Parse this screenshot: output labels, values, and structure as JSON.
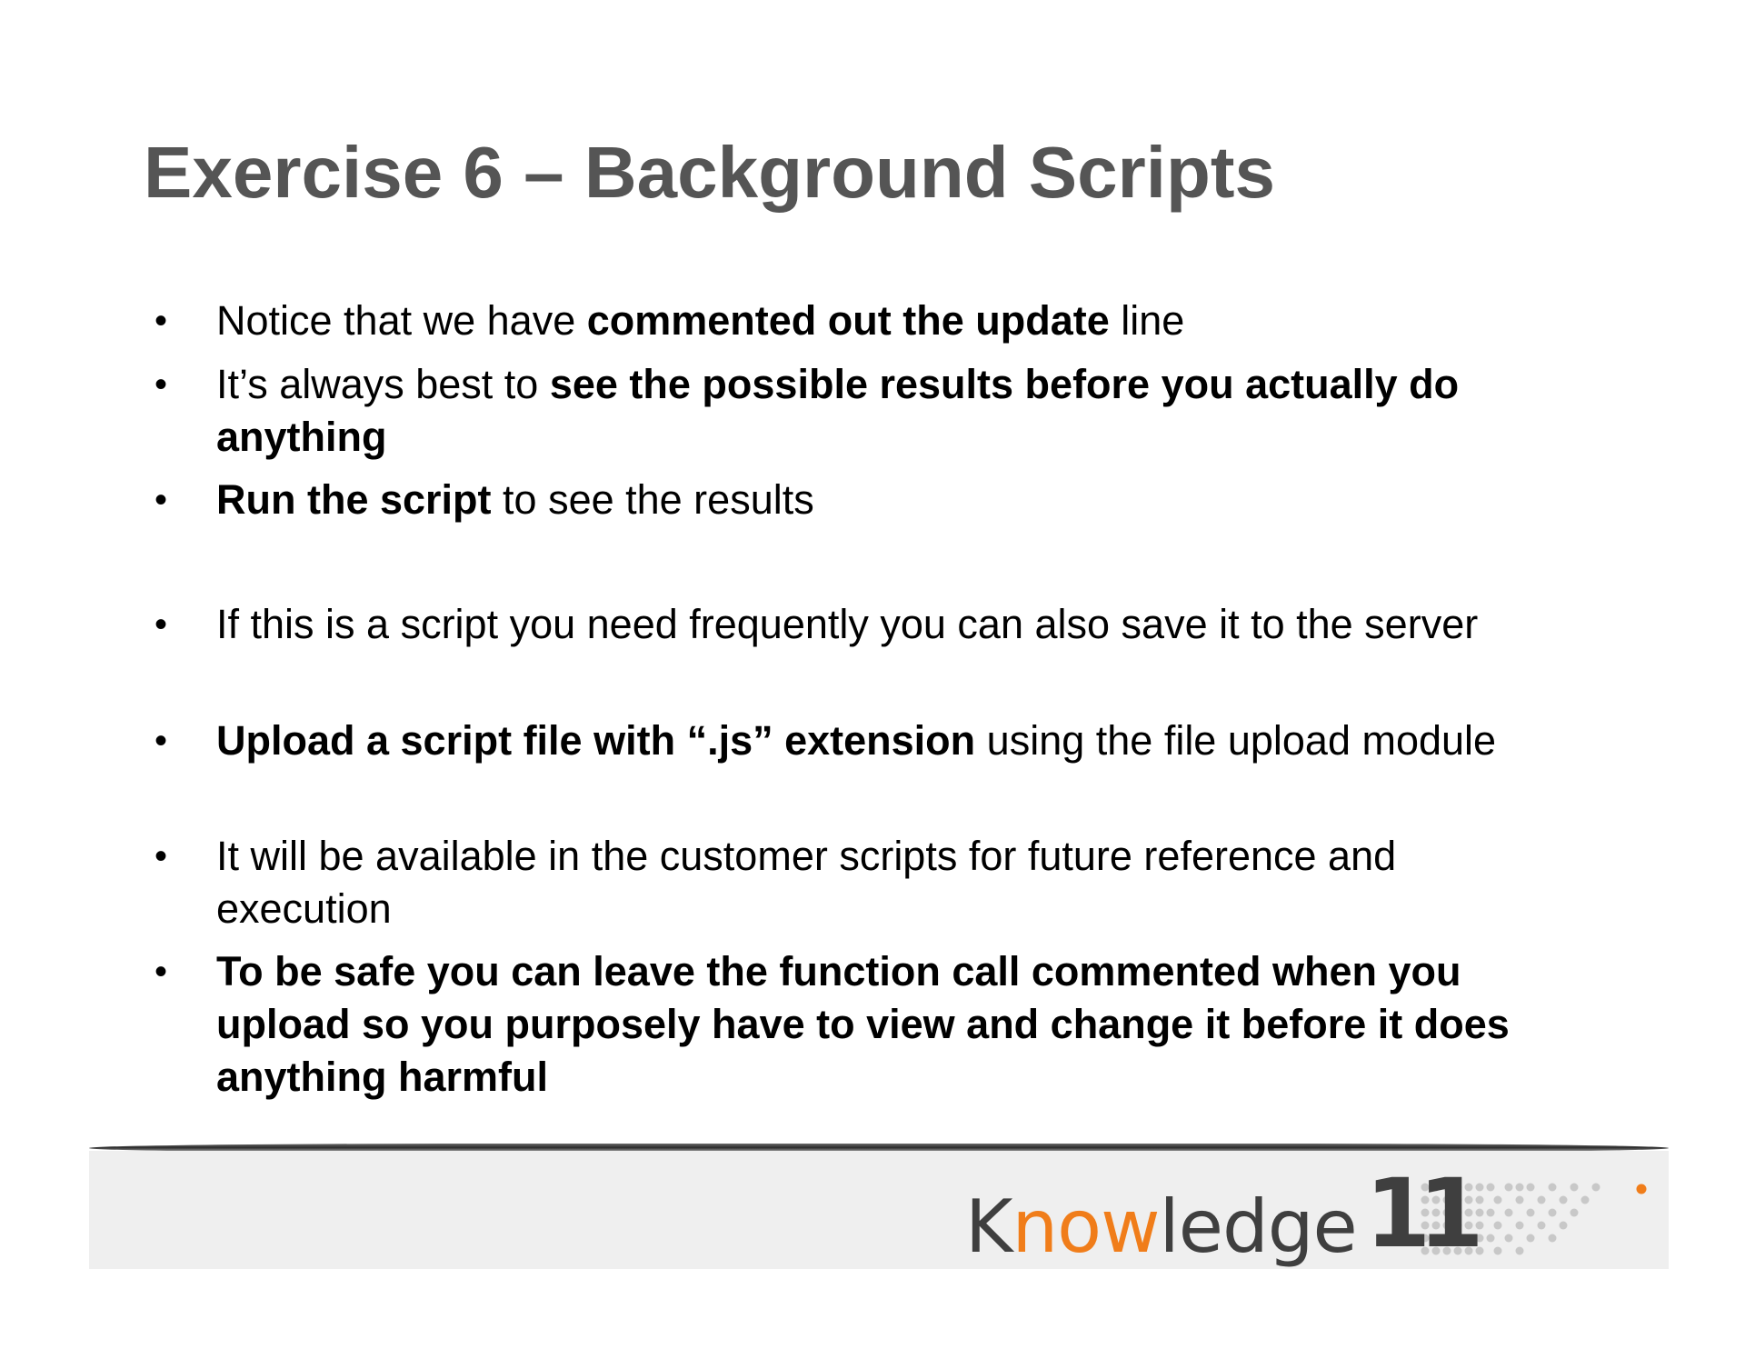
{
  "title": "Exercise 6 – Background Scripts",
  "bullets": [
    {
      "before": "Notice that we have ",
      "bold": "commented out the update",
      "after": " line"
    },
    {
      "before": "It’s always best to ",
      "bold": "see the possible results before you actually do anything",
      "after": ""
    },
    {
      "before": "",
      "bold": "Run the script",
      "after": " to see the results"
    },
    {
      "before": "If this is a script you need frequently you can also save it to the server",
      "bold": "",
      "after": ""
    },
    {
      "before": "",
      "bold": "Upload a script file with “.js” extension",
      "after": " using the file upload module"
    },
    {
      "before": "It will be available in the customer scripts for future reference and execution",
      "bold": "",
      "after": ""
    },
    {
      "before": "",
      "bold": "To be safe you can leave the function call commented when you upload so you purposely have to view and change it before it does anything harmful",
      "after": ""
    }
  ],
  "bullet_symbol": "•",
  "logo": {
    "part1": "K",
    "part2": "now",
    "part3": "ledge",
    "number": "11",
    "text_color": "#3f3f3f",
    "accent_color": "#f07d1a"
  }
}
